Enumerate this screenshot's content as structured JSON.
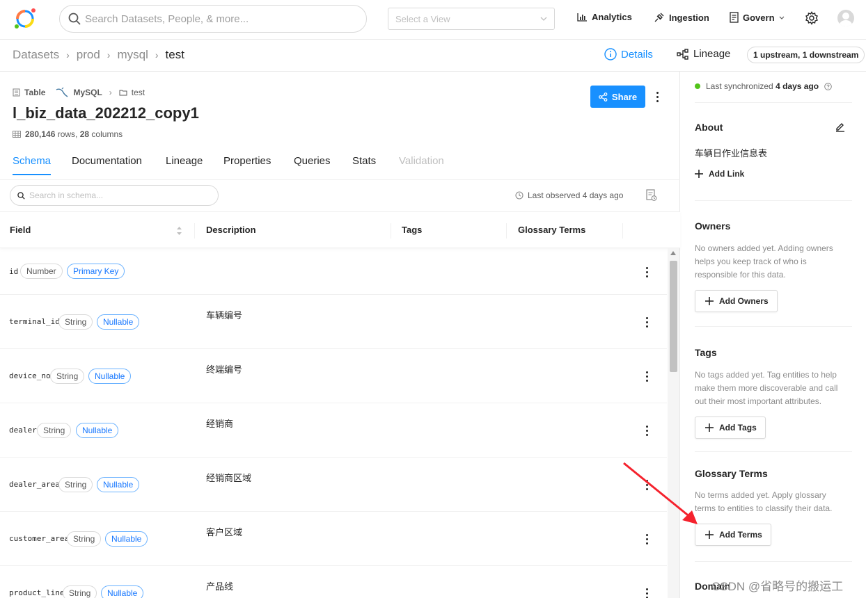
{
  "topnav": {
    "search_placeholder": "Search Datasets, People, & more...",
    "view_placeholder": "Select a View",
    "analytics": "Analytics",
    "ingestion": "Ingestion",
    "govern": "Govern"
  },
  "breadcrumb": {
    "items": [
      "Datasets",
      "prod",
      "mysql",
      "test"
    ],
    "details_tab": "Details",
    "lineage_tab": "Lineage",
    "lineage_badge": "1 upstream, 1 downstream"
  },
  "entity": {
    "type": "Table",
    "platform": "MySQL",
    "container": "test",
    "title": "l_biz_data_202212_copy1",
    "row_count": "280,146",
    "rows_label": " rows, ",
    "col_count": "28",
    "cols_label": " columns",
    "share_label": "Share"
  },
  "tabs": [
    "Schema",
    "Documentation",
    "Lineage",
    "Properties",
    "Queries",
    "Stats",
    "Validation"
  ],
  "schema": {
    "search_placeholder": "Search in schema...",
    "last_observed": "Last observed 4 days ago",
    "columns": [
      "Field",
      "Description",
      "Tags",
      "Glossary Terms"
    ],
    "rows": [
      {
        "field": "id",
        "type": "Number",
        "badge": "Primary Key",
        "desc": ""
      },
      {
        "field": "terminal_id",
        "type": "String",
        "badge": "Nullable",
        "desc": "车辆编号"
      },
      {
        "field": "device_no",
        "type": "String",
        "badge": "Nullable",
        "desc": "终端编号"
      },
      {
        "field": "dealer",
        "type": "String",
        "badge": "Nullable",
        "desc": "经销商"
      },
      {
        "field": "dealer_area",
        "type": "String",
        "badge": "Nullable",
        "desc": "经销商区域"
      },
      {
        "field": "customer_area",
        "type": "String",
        "badge": "Nullable",
        "desc": "客户区域"
      },
      {
        "field": "product_line",
        "type": "String",
        "badge": "Nullable",
        "desc": "产品线"
      }
    ]
  },
  "sidebar": {
    "sync_prefix": "Last synchronized ",
    "sync_value": "4 days ago",
    "about_title": "About",
    "about_text": "车辆日作业信息表",
    "add_link": "Add Link",
    "owners_title": "Owners",
    "owners_text": "No owners added yet. Adding owners helps you keep track of who is responsible for this data.",
    "add_owners": "Add Owners",
    "tags_title": "Tags",
    "tags_text": "No tags added yet. Tag entities to help make them more discoverable and call out their most important attributes.",
    "add_tags": "Add Tags",
    "glossary_title": "Glossary Terms",
    "glossary_text": "No terms added yet. Apply glossary terms to entities to classify their data.",
    "add_terms": "Add Terms",
    "domain_title": "Domain"
  },
  "watermark": "CSDN @省略号的搬运工",
  "colors": {
    "accent": "#1890ff",
    "sync_dot": "#52c41a",
    "annotation_arrow": "#f5222d"
  }
}
